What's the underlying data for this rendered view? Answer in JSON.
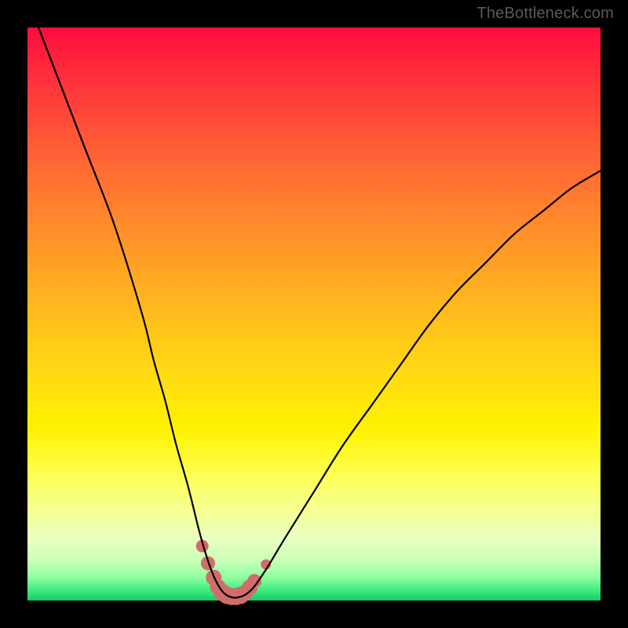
{
  "watermark": "TheBottleneck.com",
  "colors": {
    "frame": "#000000",
    "curve_stroke": "#000000",
    "marker_fill": "#cf6d6d",
    "marker_stroke": "#cf6d6d"
  },
  "chart_data": {
    "type": "line",
    "title": "",
    "xlabel": "",
    "ylabel": "",
    "xlim": [
      0,
      100
    ],
    "ylim": [
      0,
      100
    ],
    "grid": false,
    "legend": false,
    "annotations": [
      "TheBottleneck.com"
    ],
    "series": [
      {
        "name": "bottleneck-curve",
        "x": [
          0,
          5,
          10,
          15,
          20,
          22,
          24,
          26,
          28,
          30,
          31,
          32,
          33,
          34,
          35,
          36,
          37,
          38,
          39,
          40,
          42,
          45,
          50,
          55,
          60,
          65,
          70,
          75,
          80,
          85,
          90,
          95,
          100
        ],
        "y": [
          105,
          92,
          79,
          66,
          50,
          42,
          35,
          27,
          20,
          12,
          8.5,
          5.5,
          3.2,
          1.6,
          0.8,
          0.5,
          0.6,
          1.0,
          1.8,
          3.0,
          6.0,
          11,
          19,
          27,
          34,
          41,
          48,
          54,
          59,
          64,
          68,
          72,
          75
        ]
      }
    ],
    "markers": {
      "name": "highlight-dots",
      "x": [
        30.5,
        31.5,
        32.5,
        33.2,
        34.0,
        34.8,
        35.6,
        36.4,
        37.2,
        38.0,
        38.8,
        39.6,
        41.6
      ],
      "y": [
        9.5,
        6.5,
        4.0,
        2.4,
        1.4,
        0.9,
        0.7,
        0.7,
        0.9,
        1.4,
        2.3,
        3.4,
        6.3
      ],
      "r": [
        8,
        9,
        10,
        10,
        11,
        11,
        11,
        11,
        11,
        10,
        10,
        9,
        6.5
      ]
    }
  }
}
